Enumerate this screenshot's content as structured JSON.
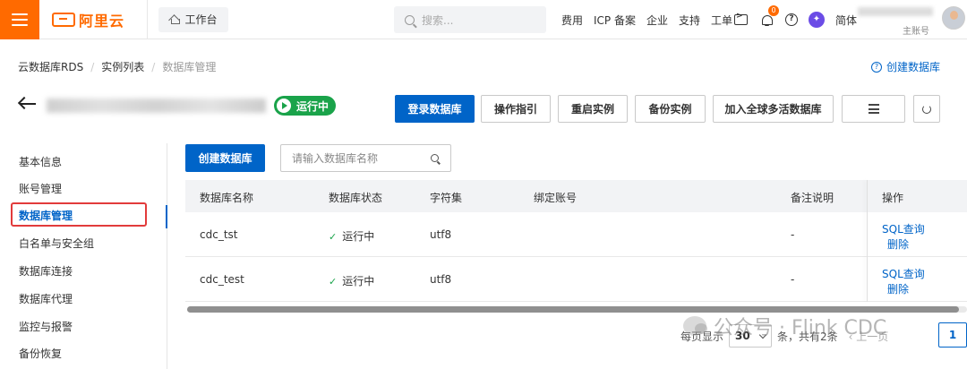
{
  "topbar": {
    "brand": "阿里云",
    "workbench": "工作台",
    "search_placeholder": "搜索...",
    "nav": [
      "费用",
      "ICP 备案",
      "企业",
      "支持",
      "工单"
    ],
    "notification_count": "0",
    "lang": "简体",
    "account_sub": "主账号",
    "brand_color": "#ff6a00"
  },
  "breadcrumb": {
    "items": [
      "云数据库RDS",
      "实例列表",
      "数据库管理"
    ],
    "create_link": "创建数据库"
  },
  "instance": {
    "status": "运行中",
    "status_color": "#1aa34a"
  },
  "actions": {
    "login": "登录数据库",
    "guide": "操作指引",
    "restart": "重启实例",
    "backup": "备份实例",
    "global": "加入全球多活数据库"
  },
  "sidenav": {
    "items": [
      "基本信息",
      "账号管理",
      "数据库管理",
      "白名单与安全组",
      "数据库连接",
      "数据库代理",
      "监控与报警",
      "备份恢复"
    ],
    "active": "数据库管理"
  },
  "content": {
    "create_button": "创建数据库",
    "search_placeholder": "请输入数据库名称",
    "columns": [
      "数据库名称",
      "数据库状态",
      "字符集",
      "绑定账号",
      "备注说明",
      "操作"
    ],
    "rows": [
      {
        "name": "cdc_tst",
        "status": "运行中",
        "charset": "utf8",
        "account": "",
        "remark": "-",
        "op_query": "SQL查询",
        "op_delete": "删除"
      },
      {
        "name": "cdc_test",
        "status": "运行中",
        "charset": "utf8",
        "account": "",
        "remark": "-",
        "op_query": "SQL查询",
        "op_delete": "删除"
      }
    ]
  },
  "pager": {
    "per_page_prefix": "每页显示",
    "per_page": "30",
    "total_text": "条，共有2条",
    "prev": "上一页",
    "current_page": "1"
  },
  "watermark": {
    "text": "公众号 · Flink CDC"
  }
}
